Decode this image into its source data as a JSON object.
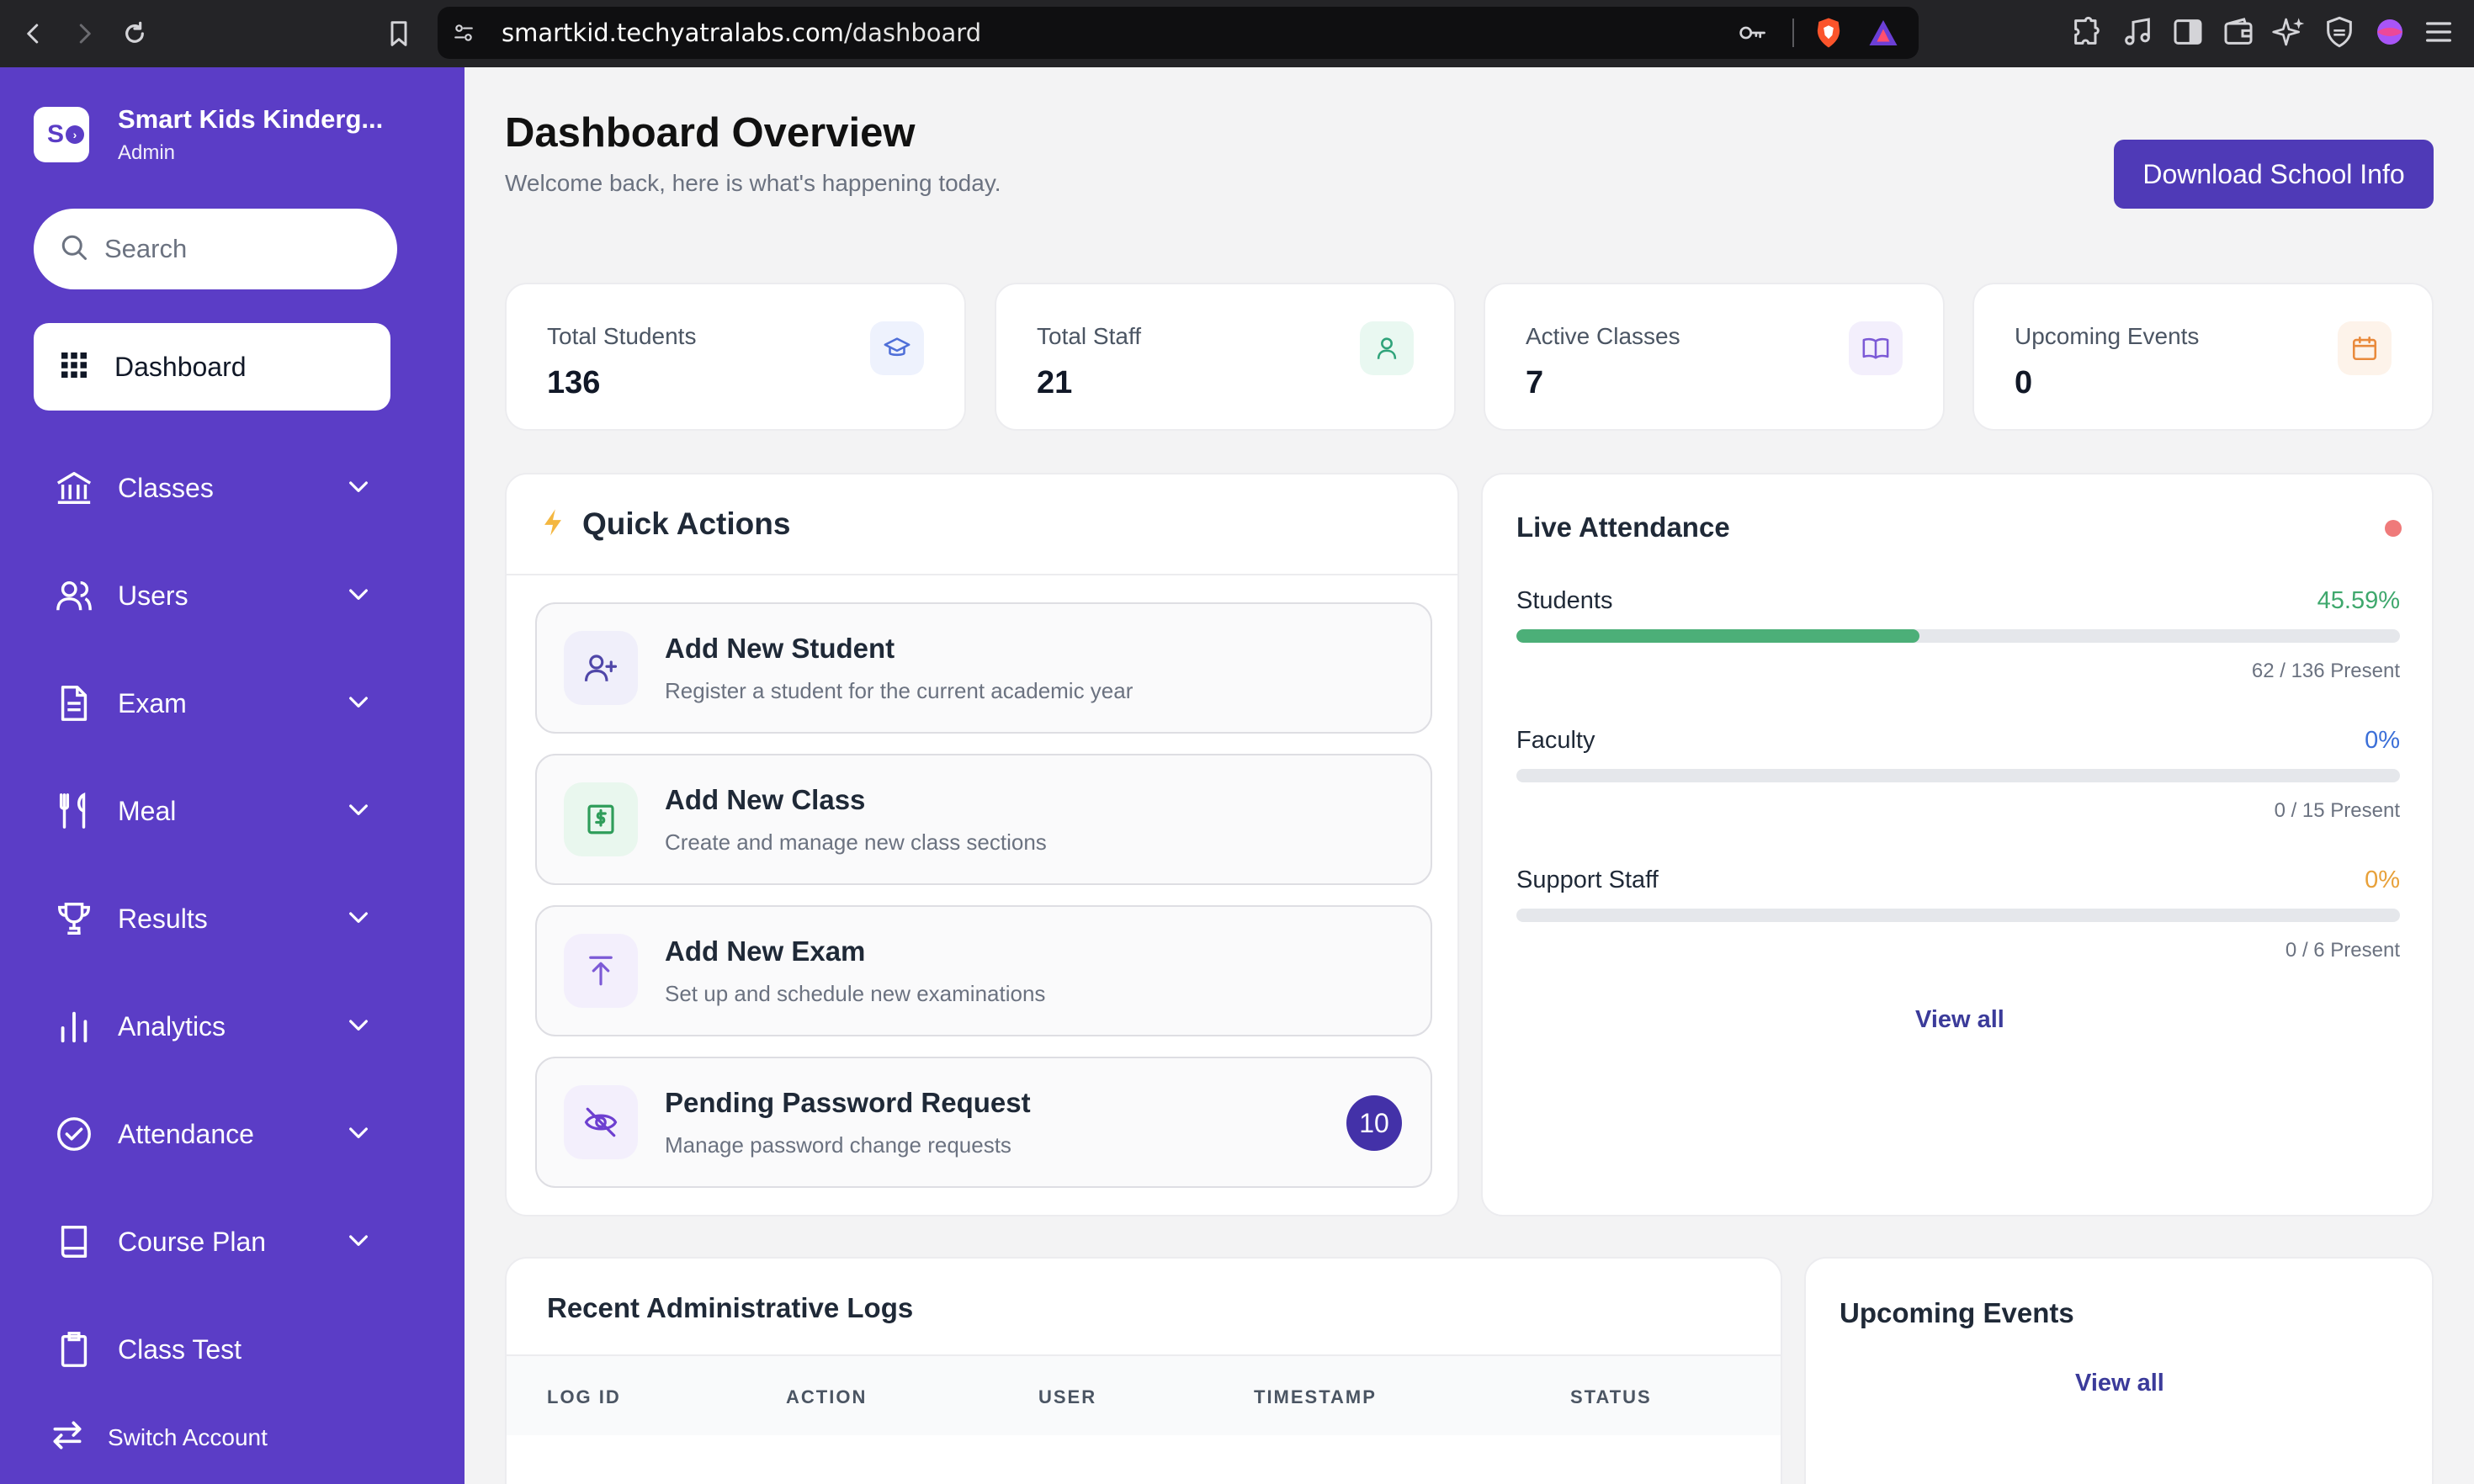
{
  "browser": {
    "url_host": "smartkid.techyatralabs.com",
    "url_path": "/dashboard"
  },
  "sidebar": {
    "brand_name": "Smart Kids Kinderg...",
    "brand_role": "Admin",
    "brand_initial": "S",
    "search_placeholder": "Search",
    "dashboard_label": "Dashboard",
    "items": [
      {
        "label": "Classes",
        "icon": "building-columns-icon"
      },
      {
        "label": "Users",
        "icon": "users-icon"
      },
      {
        "label": "Exam",
        "icon": "document-icon"
      },
      {
        "label": "Meal",
        "icon": "fork-knife-icon"
      },
      {
        "label": "Results",
        "icon": "trophy-icon"
      },
      {
        "label": "Analytics",
        "icon": "bar-chart-icon"
      },
      {
        "label": "Attendance",
        "icon": "check-circle-icon"
      },
      {
        "label": "Course Plan",
        "icon": "book-icon"
      },
      {
        "label": "Class Test",
        "icon": "clipboard-icon"
      }
    ],
    "switch_account_label": "Switch Account"
  },
  "header": {
    "title": "Dashboard Overview",
    "subtitle": "Welcome back, here is what's happening today.",
    "download_label": "Download School Info"
  },
  "stats": [
    {
      "label": "Total Students",
      "value": "136",
      "icon": "graduation-cap-icon",
      "color": "#4f6fd8",
      "bg": "#eef2fd"
    },
    {
      "label": "Total Staff",
      "value": "21",
      "icon": "person-icon",
      "color": "#2fa37a",
      "bg": "#e9f8f1"
    },
    {
      "label": "Active Classes",
      "value": "7",
      "icon": "open-book-icon",
      "color": "#7c5ad6",
      "bg": "#f3effc"
    },
    {
      "label": "Upcoming Events",
      "value": "0",
      "icon": "calendar-icon",
      "color": "#e98a3c",
      "bg": "#fdf3ea"
    }
  ],
  "quick_actions": {
    "title": "Quick Actions",
    "items": [
      {
        "title": "Add New Student",
        "desc": "Register a student for the current academic year",
        "icon": "user-plus-icon"
      },
      {
        "title": "Add New Class",
        "desc": "Create and manage new class sections",
        "icon": "dollar-receipt-icon"
      },
      {
        "title": "Add New Exam",
        "desc": "Set up and schedule new examinations",
        "icon": "upload-arrow-icon"
      },
      {
        "title": "Pending Password Request",
        "desc": "Manage password change requests",
        "icon": "eye-off-icon",
        "badge": "10"
      }
    ]
  },
  "live_attendance": {
    "title": "Live Attendance",
    "rows": [
      {
        "label": "Students",
        "pct": "45.59%",
        "fraction": 0.4559,
        "count": "62 / 136 Present",
        "color": "#3fa86d"
      },
      {
        "label": "Faculty",
        "pct": "0%",
        "fraction": 0,
        "count": "0 / 15 Present",
        "color": "#3b6fd8"
      },
      {
        "label": "Support Staff",
        "pct": "0%",
        "fraction": 0,
        "count": "0 / 6 Present",
        "color": "#e8a13a"
      }
    ],
    "view_all": "View all"
  },
  "logs": {
    "title": "Recent Administrative Logs",
    "columns": [
      "LOG ID",
      "ACTION",
      "USER",
      "TIMESTAMP",
      "STATUS"
    ]
  },
  "events": {
    "title": "Upcoming Events",
    "view_all": "View all"
  }
}
